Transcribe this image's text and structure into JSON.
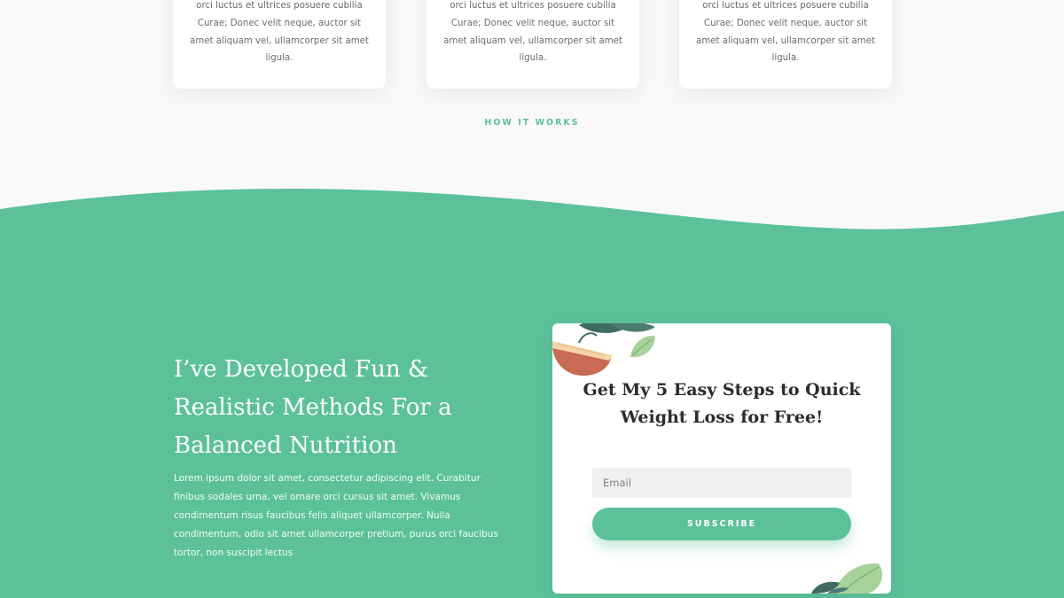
{
  "features": {
    "cards": [
      {
        "text": "Vestibulum ante ipsum primis in faucibus orci luctus et ultrices posuere cubilia Curae; Donec velit neque, auctor sit amet aliquam vel, ullamcorper sit amet ligula."
      },
      {
        "text": "Vestibulum ante ipsum primis in faucibus orci luctus et ultrices posuere cubilia Curae; Donec velit neque, auctor sit amet aliquam vel, ullamcorper sit amet ligula."
      },
      {
        "text": "Vestibulum ante ipsum primis in faucibus orci luctus et ultrices posuere cubilia Curae; Donec velit neque, auctor sit amet aliquam vel, ullamcorper sit amet ligula."
      }
    ],
    "link_label": "HOW IT WORKS"
  },
  "hero": {
    "headline": "I’ve Developed Fun & Realistic Methods For a Balanced Nutrition",
    "body": "Lorem ipsum dolor sit amet, consectetur adipiscing elit. Curabitur finibus sodales urna, vel ornare orci cursus sit amet. Vivamus condimentum risus faucibus felis aliquet ullamcorper. Nulla condimentum, odio sit amet ullamcorper pretium, purus orci faucibus tortor, non suscipit lectus"
  },
  "signup": {
    "title": "Get My 5 Easy Steps to Quick Weight Loss for Free!",
    "email_placeholder": "Email",
    "email_value": "",
    "button_label": "SUBSCRIBE"
  },
  "icons": {
    "top_decoration": "grapefruit-leaves-icon",
    "bottom_decoration": "leaves-icon"
  },
  "colors": {
    "accent": "#5cc19b",
    "page_background": "#f9f9fa",
    "card_background": "#ffffff",
    "heading_text": "#2b2b2b",
    "body_text": "#6b6b6b",
    "input_background": "#f0f0f0"
  }
}
